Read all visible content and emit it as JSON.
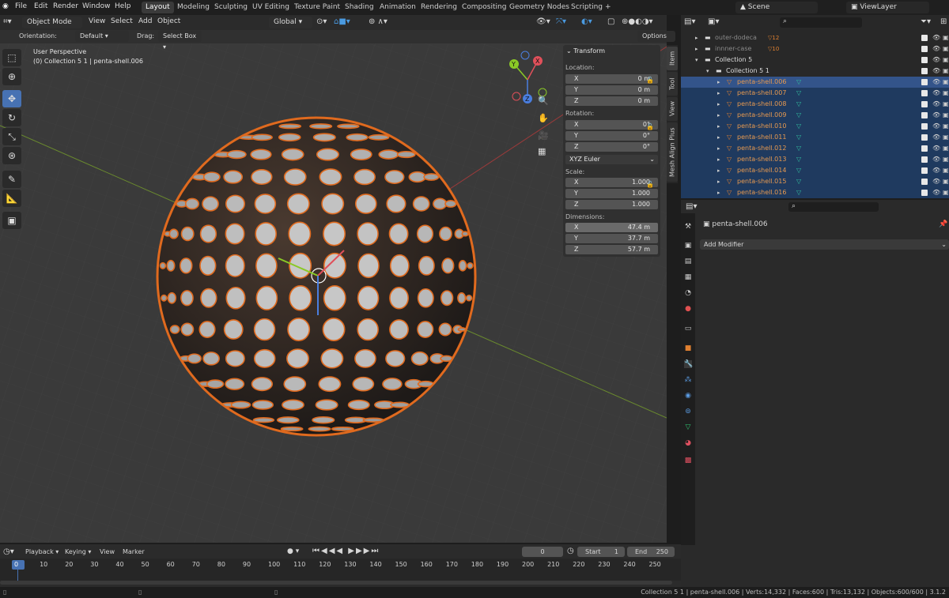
{
  "menu": [
    "File",
    "Edit",
    "Render",
    "Window",
    "Help"
  ],
  "workspaces": [
    "Layout",
    "Modeling",
    "Sculpting",
    "UV Editing",
    "Texture Paint",
    "Shading",
    "Animation",
    "Rendering",
    "Compositing",
    "Geometry Nodes",
    "Scripting",
    "+"
  ],
  "scene": "Scene",
  "view_layer": "ViewLayer",
  "header": {
    "mode": "Object Mode",
    "menus": [
      "View",
      "Select",
      "Add",
      "Object"
    ],
    "orientation_label": "Orientation:",
    "orientation_value": "Default",
    "drag_label": "Drag:",
    "drag_value": "Select Box",
    "transform_orientation": "Global",
    "options": "Options"
  },
  "viewport": {
    "perspective": "User Perspective",
    "collection_info": "(0) Collection 5 1 | penta-shell.006"
  },
  "transform": {
    "title": "Transform",
    "location_label": "Location:",
    "location": [
      {
        "k": "X",
        "v": "0 m"
      },
      {
        "k": "Y",
        "v": "0 m"
      },
      {
        "k": "Z",
        "v": "0 m"
      }
    ],
    "rotation_label": "Rotation:",
    "rotation": [
      {
        "k": "X",
        "v": "0°"
      },
      {
        "k": "Y",
        "v": "0°"
      },
      {
        "k": "Z",
        "v": "0°"
      }
    ],
    "rotation_mode": "XYZ Euler",
    "scale_label": "Scale:",
    "scale": [
      {
        "k": "X",
        "v": "1.000"
      },
      {
        "k": "Y",
        "v": "1.000"
      },
      {
        "k": "Z",
        "v": "1.000"
      }
    ],
    "dimensions_label": "Dimensions:",
    "dimensions": [
      {
        "k": "X",
        "v": "47.4 m"
      },
      {
        "k": "Y",
        "v": "37.7 m"
      },
      {
        "k": "Z",
        "v": "57.7 m"
      }
    ]
  },
  "side_tabs": [
    "Item",
    "Tool",
    "View",
    "Mesh Align Plus"
  ],
  "outliner": {
    "rows": [
      {
        "name": "outer-dodeca",
        "badge": "12"
      },
      {
        "name": "innner-case",
        "badge": "10"
      },
      {
        "name": "Collection 5",
        "badge": ""
      },
      {
        "name": "Collection 5 1",
        "badge": ""
      },
      {
        "name": "penta-shell.006",
        "badge": ""
      },
      {
        "name": "penta-shell.007",
        "badge": ""
      },
      {
        "name": "penta-shell.008",
        "badge": ""
      },
      {
        "name": "penta-shell.009",
        "badge": ""
      },
      {
        "name": "penta-shell.010",
        "badge": ""
      },
      {
        "name": "penta-shell.011",
        "badge": ""
      },
      {
        "name": "penta-shell.012",
        "badge": ""
      },
      {
        "name": "penta-shell.013",
        "badge": ""
      },
      {
        "name": "penta-shell.014",
        "badge": ""
      },
      {
        "name": "penta-shell.015",
        "badge": ""
      },
      {
        "name": "penta-shell.016",
        "badge": ""
      }
    ]
  },
  "properties": {
    "object_name": "penta-shell.006",
    "add_modifier": "Add Modifier"
  },
  "timeline": {
    "menus": [
      "Playback",
      "Keying",
      "View",
      "Marker"
    ],
    "current_frame": "0",
    "start_label": "Start",
    "start": "1",
    "end_label": "End",
    "end": "250",
    "frames": [
      "0",
      "10",
      "20",
      "30",
      "40",
      "50",
      "60",
      "70",
      "80",
      "90",
      "100",
      "110",
      "120",
      "130",
      "140",
      "150",
      "160",
      "170",
      "180",
      "190",
      "200",
      "210",
      "220",
      "230",
      "240",
      "250"
    ]
  },
  "status_text": "Collection 5 1 | penta-shell.006 | Verts:14,332 | Faces:600 | Tris:13,132 | Objects:600/600 | 3.1.2",
  "colors": {
    "accent": "#4772b3",
    "orange": "#e06a1e",
    "selected_row": "#33548a"
  }
}
